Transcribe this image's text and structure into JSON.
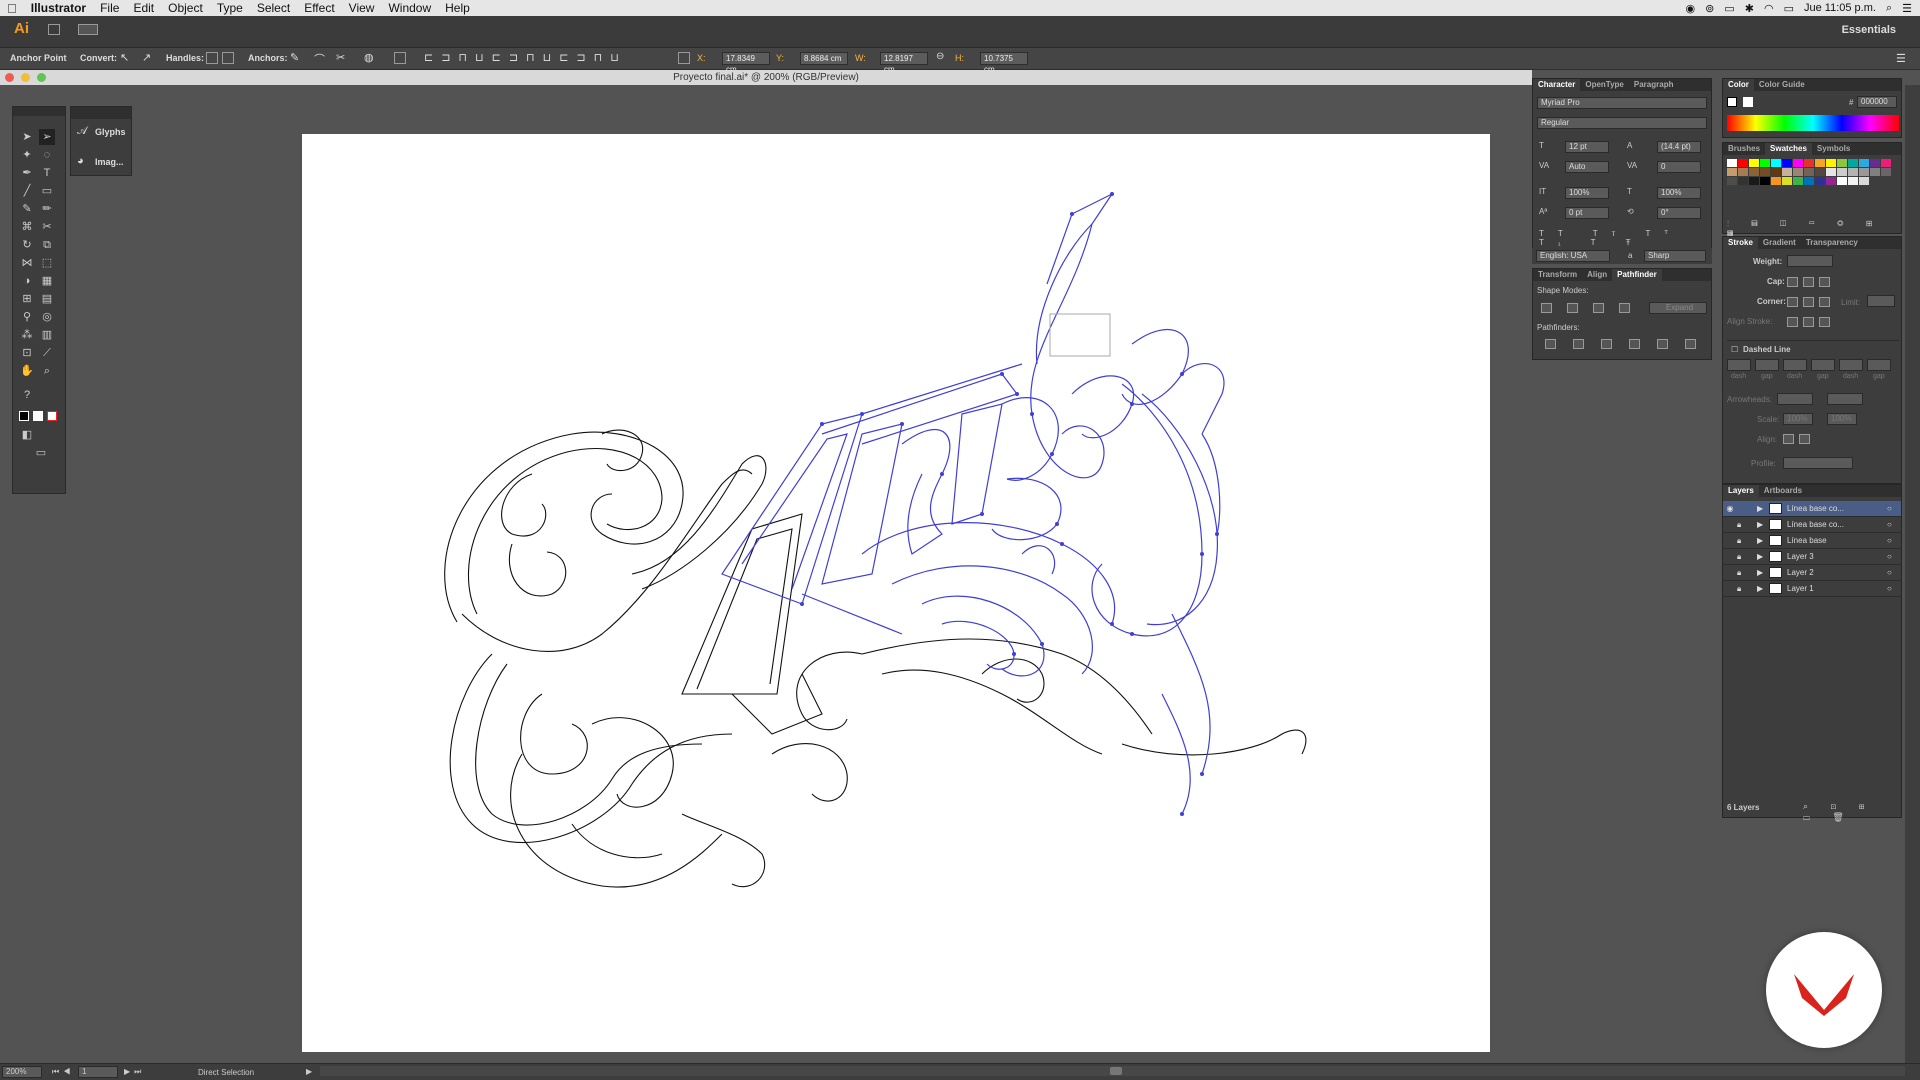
{
  "menubar": {
    "apple": "",
    "items": [
      "Illustrator",
      "File",
      "Edit",
      "Object",
      "Type",
      "Select",
      "Effect",
      "View",
      "Window",
      "Help"
    ],
    "clock": "Jue 11:05 p.m."
  },
  "appbar": {
    "logo": "Ai",
    "workspace": "Essentials"
  },
  "control": {
    "tool_name": "Anchor Point",
    "convert": "Convert:",
    "handles": "Handles:",
    "anchors": "Anchors:",
    "x_label": "X:",
    "x": "17.8349 cm",
    "y_label": "Y:",
    "y": "8.8684 cm",
    "w_label": "W:",
    "w": "12.8197 cm",
    "h_label": "H:",
    "h": "10.7375 cm"
  },
  "document": {
    "title": "Proyecto final.ai* @ 200% (RGB/Preview)"
  },
  "glyphs_panel": {
    "items": [
      "Glyphs",
      "Imag..."
    ]
  },
  "character": {
    "tabs": [
      "Character",
      "OpenType",
      "Paragraph"
    ],
    "font": "Myriad Pro",
    "style": "Regular",
    "size": "12 pt",
    "leading": "(14.4 pt)",
    "kerning": "Auto",
    "tracking": "0",
    "vscale": "100%",
    "hscale": "100%",
    "baseline": "0 pt",
    "rotate": "0°",
    "language": "English: USA",
    "aa_label": "a",
    "antialias": "Sharp"
  },
  "pathfinder": {
    "tabs": [
      "Transform",
      "Align",
      "Pathfinder"
    ],
    "shape_modes": "Shape Modes:",
    "expand": "Expand",
    "pathfinders": "Pathfinders:"
  },
  "color": {
    "tabs": [
      "Color",
      "Color Guide"
    ],
    "hex": "000000",
    "hash": "#"
  },
  "swatches": {
    "tabs": [
      "Brushes",
      "Swatches",
      "Symbols"
    ],
    "colors": [
      "#ffffff",
      "#ff0000",
      "#ffff00",
      "#00ff00",
      "#00ffff",
      "#0000ff",
      "#ff00ff",
      "#e5332a",
      "#f6a623",
      "#fff200",
      "#8cc63f",
      "#00a99d",
      "#29abe2",
      "#662d91",
      "#ed1e79",
      "#c69c6d",
      "#a67c52",
      "#8c6239",
      "#754c24",
      "#603813",
      "#c7b299",
      "#998675",
      "#736357",
      "#534741",
      "#e6e6e6",
      "#cccccc",
      "#b3b3b3",
      "#999999",
      "#808080",
      "#666666",
      "#4d4d4d",
      "#333333",
      "#1a1a1a",
      "#000000",
      "#f7931e",
      "#d9e021",
      "#39b54a",
      "#0071bc",
      "#2e3192",
      "#92278f",
      "#ffffff",
      "#f2f2f2",
      "#d9d9d9"
    ]
  },
  "stroke": {
    "tabs": [
      "Stroke",
      "Gradient",
      "Transparency"
    ],
    "weight": "Weight:",
    "cap": "Cap:",
    "corner": "Corner:",
    "limit": "Limit:",
    "align": "Align Stroke:",
    "dashed": "Dashed Line",
    "dash_labels": [
      "dash",
      "gap",
      "dash",
      "gap",
      "dash",
      "gap"
    ],
    "arrowheads": "Arrowheads:",
    "scale": "Scale:",
    "scale_a": "100%",
    "scale_b": "100%",
    "align2": "Align:",
    "profile": "Profile:"
  },
  "layers": {
    "tabs": [
      "Layers",
      "Artboards"
    ],
    "rows": [
      "Línea base co...",
      "Línea base co...",
      "Línea base",
      "Layer 3",
      "Layer 2",
      "Layer 1"
    ],
    "count": "6 Layers"
  },
  "status": {
    "zoom": "200%",
    "page": "1",
    "tool": "Direct Selection"
  },
  "colors": {
    "accent": "#4a4adc",
    "brand": "#d9231d"
  }
}
